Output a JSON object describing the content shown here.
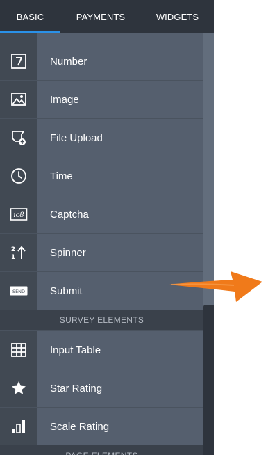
{
  "tabs": [
    {
      "label": "BASIC",
      "active": true
    },
    {
      "label": "PAYMENTS",
      "active": false
    },
    {
      "label": "WIDGETS",
      "active": false
    }
  ],
  "fields": [
    {
      "label": "Number",
      "icon": "number-7-icon"
    },
    {
      "label": "Image",
      "icon": "image-icon"
    },
    {
      "label": "File Upload",
      "icon": "file-upload-icon"
    },
    {
      "label": "Time",
      "icon": "clock-icon"
    },
    {
      "label": "Captcha",
      "icon": "captcha-icon",
      "icon_text": "ic8"
    },
    {
      "label": "Spinner",
      "icon": "spinner-icon",
      "icon_text": "2 1"
    },
    {
      "label": "Submit",
      "icon": "send-button-icon",
      "icon_text": "SEND"
    }
  ],
  "survey_section": "SURVEY ELEMENTS",
  "survey_fields": [
    {
      "label": "Input Table",
      "icon": "table-grid-icon"
    },
    {
      "label": "Star Rating",
      "icon": "star-icon"
    },
    {
      "label": "Scale Rating",
      "icon": "bar-chart-icon"
    }
  ],
  "page_section": "PAGE ELEMENTS",
  "colors": {
    "tab_bar": "#2e343d",
    "active_tab_underline": "#2a91e8",
    "icon_column": "#414953",
    "label_column": "#555f6e",
    "section_header": "#3a414b",
    "arrow": "#f07a1a"
  }
}
